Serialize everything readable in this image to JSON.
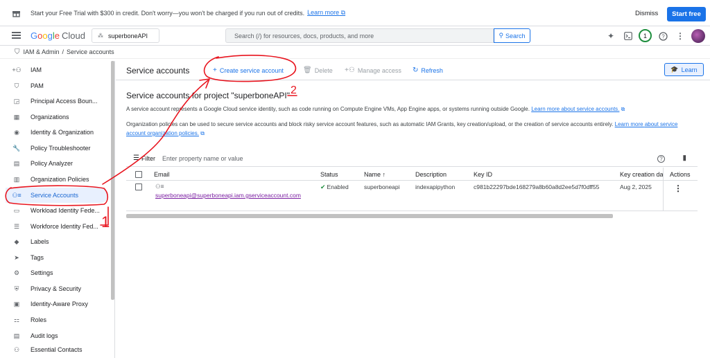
{
  "banner": {
    "text": "Start your Free Trial with $300 in credit. Don't worry—you won't be charged if you run out of credits.",
    "learn_more": "Learn more",
    "dismiss": "Dismiss",
    "start_free": "Start free"
  },
  "header": {
    "logo_google": [
      "G",
      "o",
      "o",
      "g",
      "l",
      "e"
    ],
    "logo_cloud": "Cloud",
    "project": "superboneAPI",
    "search_placeholder": "Search (/) for resources, docs, products, and more",
    "search_button": "Search",
    "notification_count": "1"
  },
  "breadcrumb": {
    "section": "IAM & Admin",
    "page": "Service accounts"
  },
  "sidebar": {
    "items": [
      {
        "label": "IAM",
        "icon": "add-person-icon"
      },
      {
        "label": "PAM",
        "icon": "shield-icon"
      },
      {
        "label": "Principal Access Boun...",
        "icon": "access-boundary-icon"
      },
      {
        "label": "Organizations",
        "icon": "organization-icon"
      },
      {
        "label": "Identity & Organization",
        "icon": "account-circle-icon"
      },
      {
        "label": "Policy Troubleshooter",
        "icon": "wrench-icon"
      },
      {
        "label": "Policy Analyzer",
        "icon": "analyzer-icon"
      },
      {
        "label": "Organization Policies",
        "icon": "document-icon"
      },
      {
        "label": "Service Accounts",
        "icon": "service-account-icon"
      },
      {
        "label": "Workload Identity Fede...",
        "icon": "workload-icon"
      },
      {
        "label": "Workforce Identity Fed...",
        "icon": "list-icon"
      },
      {
        "label": "Labels",
        "icon": "label-icon"
      },
      {
        "label": "Tags",
        "icon": "tag-icon"
      },
      {
        "label": "Settings",
        "icon": "gear-icon"
      },
      {
        "label": "Privacy & Security",
        "icon": "privacy-shield-icon"
      },
      {
        "label": "Identity-Aware Proxy",
        "icon": "proxy-icon"
      },
      {
        "label": "Roles",
        "icon": "roles-icon"
      },
      {
        "label": "Audit logs",
        "icon": "audit-icon"
      },
      {
        "label": "Essential Contacts",
        "icon": "contacts-icon"
      }
    ],
    "active_index": 8
  },
  "toolbar": {
    "title": "Service accounts",
    "create": "Create service account",
    "delete": "Delete",
    "manage_access": "Manage access",
    "refresh": "Refresh",
    "learn": "Learn"
  },
  "main": {
    "heading": "Service accounts for project \"superboneAPI\"",
    "para1": "A service account represents a Google Cloud service identity, such as code running on Compute Engine VMs, App Engine apps, or systems running outside Google.",
    "para1_link": "Learn more about service accounts.",
    "para2": "Organization policies can be used to secure service accounts and block risky service account features, such as automatic IAM Grants, key creation/upload, or the creation of service accounts entirely.",
    "para2_link_a": "Learn more",
    "para2_link_b": "about service account organization policies."
  },
  "table": {
    "filter_label": "Filter",
    "filter_placeholder": "Enter property name or value",
    "columns": {
      "email": "Email",
      "status": "Status",
      "name": "Name",
      "description": "Description",
      "key_id": "Key ID",
      "key_creation": "Key creation da",
      "actions": "Actions"
    },
    "rows": [
      {
        "email": "superboneapi@superboneapi.iam.gserviceaccount.com",
        "status": "Enabled",
        "name": "superboneapi",
        "description": "indexapipython",
        "key_id": "c981b22297bde168279a8b60a8d2ee5d7f0dff55",
        "key_creation": "Aug 2, 2025"
      }
    ]
  },
  "annotations": {
    "label_1": "1",
    "label_2": "2",
    "color": "#e8141e"
  }
}
